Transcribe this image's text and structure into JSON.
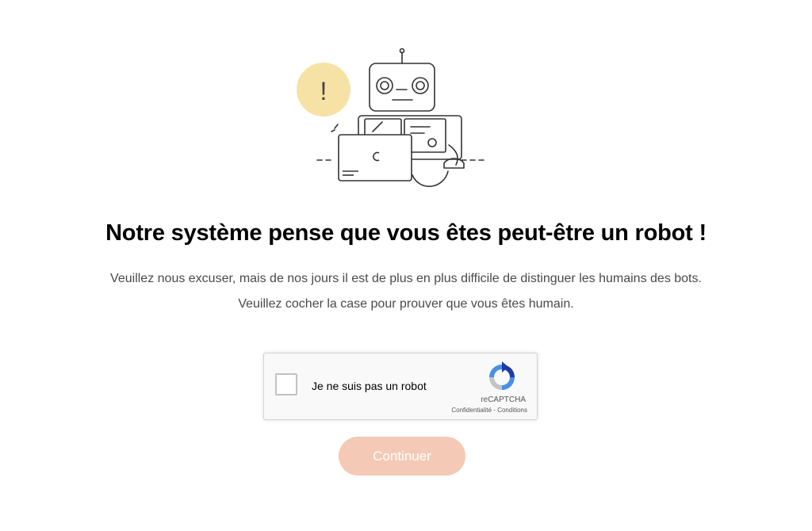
{
  "heading": "Notre système pense que vous êtes peut-être un robot !",
  "message": {
    "line1": "Veuillez nous excuser, mais de nos jours il est de plus en plus difficile de distinguer les humains des bots.",
    "line2": "Veuillez cocher la case pour prouver que vous êtes humain."
  },
  "captcha": {
    "checkbox_label": "Je ne suis pas un robot",
    "checked": false,
    "brand": "reCAPTCHA",
    "privacy_link": "Confidentialité",
    "separator": " - ",
    "terms_link": "Conditions"
  },
  "continue_button": "Continuer",
  "illustration": {
    "alert_symbol": "!",
    "icons": [
      "robot-illustration-icon",
      "exclamation-bubble-icon",
      "laptop-icon",
      "recaptcha-logo-icon"
    ]
  },
  "colors": {
    "button_bg": "#f4c9b5",
    "bubble": "#f7e2a6",
    "text_muted": "#4a4a4a"
  }
}
